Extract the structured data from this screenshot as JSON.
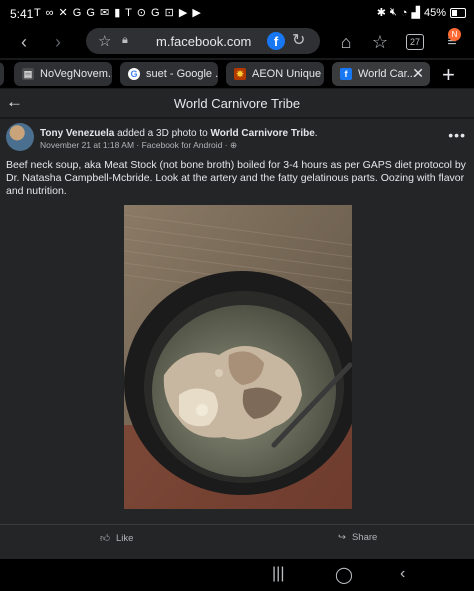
{
  "status": {
    "time": "5:41",
    "icons": "T ∞ ✕ G G ✉ ▮ T ⊙ G ⊡ ▶ ▶",
    "battery": "45%"
  },
  "browser": {
    "url": "m.facebook.com",
    "tab_count": "27",
    "profile_initial": "N",
    "tabs": [
      {
        "label": "NoVegNovem...",
        "active": false
      },
      {
        "label": "suet - Google ...",
        "active": false
      },
      {
        "label": "AEON Unique ...",
        "active": false
      },
      {
        "label": "World Car...",
        "active": true
      }
    ]
  },
  "header": {
    "title": "World Carnivore Tribe"
  },
  "post": {
    "author": "Tony Venezuela",
    "action": " added a 3D photo to ",
    "group": "World Carnivore Tribe",
    "period": ".",
    "meta": "November 21 at 1:18 AM · Facebook for Android · ",
    "text": "Beef neck soup, aka Meat Stock (not bone broth) boiled for 3-4 hours as per GAPS diet protocol by Dr. Natasha Campbell-Mcbride. Look at the artery and the fatty gelatinous parts. Oozing with flavor and nutrition.",
    "like_label": "Like",
    "share_label": "Share"
  },
  "icons": {
    "back": "arrow-left-icon",
    "forward": "arrow-right-icon",
    "bookmark": "star-icon",
    "home": "home-icon",
    "more": "more-icon"
  }
}
